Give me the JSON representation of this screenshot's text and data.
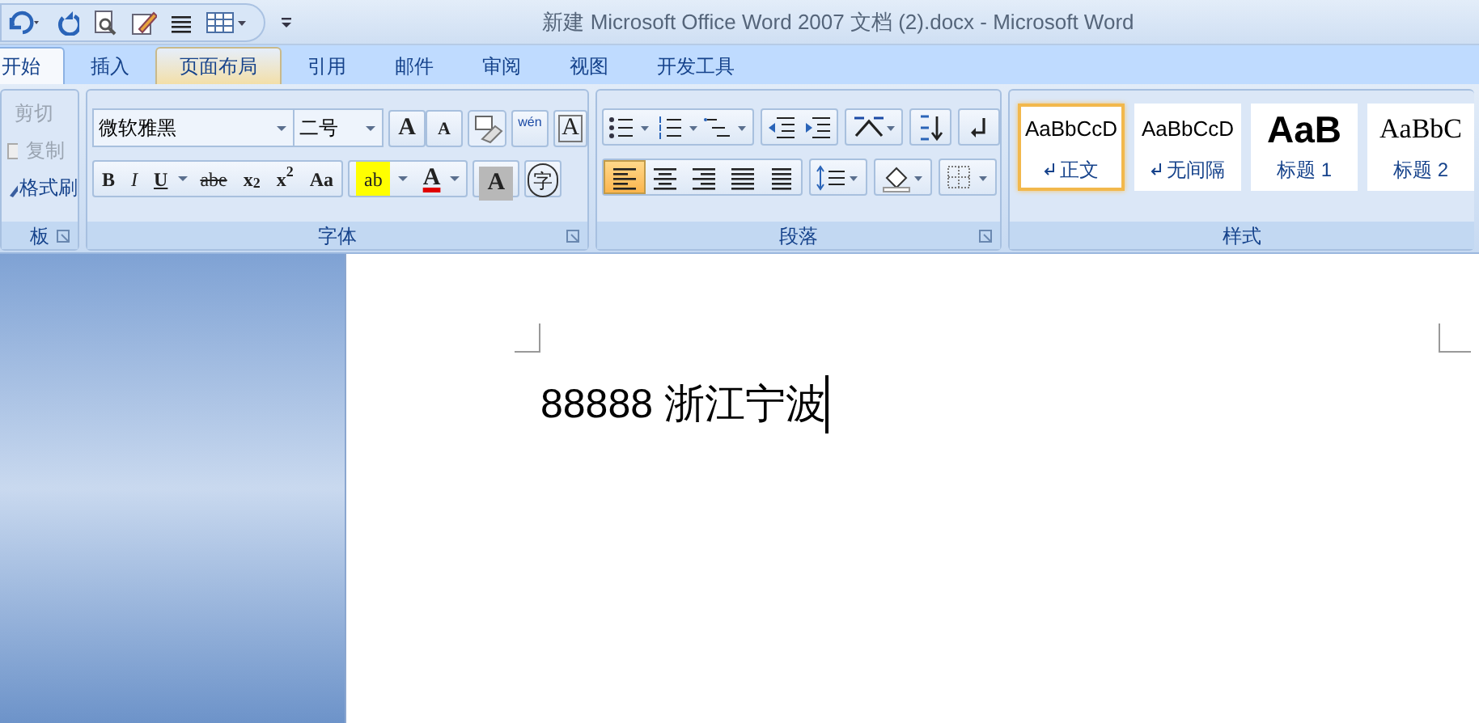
{
  "window": {
    "title": "新建 Microsoft Office Word 2007 文档 (2).docx - Microsoft Word"
  },
  "tabs": [
    {
      "label": "开始",
      "selected": true,
      "highlighted": false
    },
    {
      "label": "插入",
      "selected": false,
      "highlighted": false
    },
    {
      "label": "页面布局",
      "selected": false,
      "highlighted": true
    },
    {
      "label": "引用",
      "selected": false,
      "highlighted": false
    },
    {
      "label": "邮件",
      "selected": false,
      "highlighted": false
    },
    {
      "label": "审阅",
      "selected": false,
      "highlighted": false
    },
    {
      "label": "视图",
      "selected": false,
      "highlighted": false
    },
    {
      "label": "开发工具",
      "selected": false,
      "highlighted": false
    }
  ],
  "clipboard": {
    "label": "板",
    "items": [
      "剪切",
      "复制",
      "格式刷"
    ]
  },
  "font": {
    "label": "字体",
    "font_name": "微软雅黑",
    "font_size": "二号",
    "top_buttons": [
      "A",
      "A",
      "wén",
      "A"
    ],
    "format_buttons": [
      {
        "label": "B",
        "kind": "bold"
      },
      {
        "label": "I",
        "kind": "italic"
      },
      {
        "label": "U",
        "kind": "underline"
      },
      {
        "label": "abe",
        "kind": "strike"
      },
      {
        "label": "x$_{2}$",
        "kind": "plain"
      },
      {
        "label": "x$^{2}$",
        "kind": "plain"
      },
      {
        "label": "Aa",
        "kind": "plain"
      },
      {
        "label": "ab",
        "kind": "highlight"
      },
      {
        "label": "A",
        "kind": "color"
      },
      {
        "label": "A",
        "kind": "shade"
      },
      {
        "label": "字",
        "kind": "circle"
      }
    ]
  },
  "paragraph": {
    "label": "段落",
    "alignments": [
      {
        "selected": true
      },
      {
        "selected": false
      },
      {
        "selected": false
      },
      {
        "selected": false
      },
      {
        "selected": false
      }
    ]
  },
  "styles": {
    "label": "样式",
    "items": [
      {
        "preview": "AaBbCcD",
        "name": "正文",
        "selected": true,
        "mark": true,
        "kind": "normal"
      },
      {
        "preview": "AaBbCcD",
        "name": "无间隔",
        "selected": false,
        "mark": true,
        "kind": "normal"
      },
      {
        "preview": "AaB",
        "name": "标题 1",
        "selected": false,
        "mark": false,
        "kind": "heading1"
      },
      {
        "preview": "AaBbC",
        "name": "标题 2",
        "selected": false,
        "mark": false,
        "kind": "heading2"
      }
    ]
  },
  "document": {
    "text": "88888 浙江宁波"
  }
}
